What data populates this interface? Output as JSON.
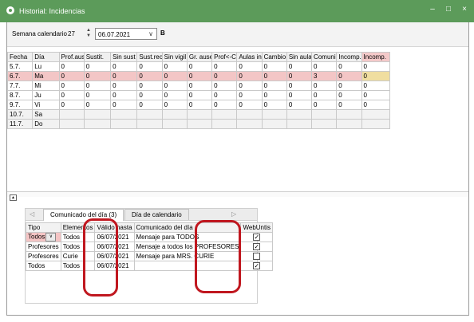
{
  "window": {
    "title": "Historial: Incidencias",
    "minimize": "–",
    "maximize": "□",
    "close": "×"
  },
  "toolbar": {
    "week_label": "Semana calendario",
    "week_value": "27",
    "date_value": "06.07.2021",
    "b_label": "B"
  },
  "grid": {
    "headers": [
      "Fecha",
      "Día",
      "Prof.aus",
      "Sustit.",
      "Sin sust",
      "Sust.rec",
      "Sin vigil",
      "Gr. ause",
      "Prof<-C",
      "Aulas in",
      "Cambio",
      "Sin aula",
      "Comuni",
      "Incomp.",
      "Incomp."
    ],
    "rows": [
      {
        "fecha": "5.7.",
        "dia": "Lu",
        "values": [
          "0",
          "0",
          "0",
          "0",
          "0",
          "0",
          "0",
          "0",
          "0",
          "0",
          "0",
          "0",
          "0"
        ]
      },
      {
        "fecha": "6.7.",
        "dia": "Ma",
        "values": [
          "0",
          "0",
          "0",
          "0",
          "0",
          "0",
          "0",
          "0",
          "0",
          "0",
          "3",
          "0",
          "0"
        ]
      },
      {
        "fecha": "7.7.",
        "dia": "Mi",
        "values": [
          "0",
          "0",
          "0",
          "0",
          "0",
          "0",
          "0",
          "0",
          "0",
          "0",
          "0",
          "0",
          "0"
        ]
      },
      {
        "fecha": "8.7.",
        "dia": "Ju",
        "values": [
          "0",
          "0",
          "0",
          "0",
          "0",
          "0",
          "0",
          "0",
          "0",
          "0",
          "0",
          "0",
          "0"
        ]
      },
      {
        "fecha": "9.7.",
        "dia": "Vi",
        "values": [
          "0",
          "0",
          "0",
          "0",
          "0",
          "0",
          "0",
          "0",
          "0",
          "0",
          "0",
          "0",
          "0"
        ]
      },
      {
        "fecha": "10.7.",
        "dia": "Sa",
        "values": [
          "",
          "",
          "",
          "",
          "",
          "",
          "",
          "",
          "",
          "",
          "",
          "",
          ""
        ]
      },
      {
        "fecha": "11.7.",
        "dia": "Do",
        "values": [
          "",
          "",
          "",
          "",
          "",
          "",
          "",
          "",
          "",
          "",
          "",
          "",
          ""
        ]
      }
    ]
  },
  "panel": {
    "tabs": [
      "Comunicado del día (3)",
      "Día de calendario"
    ],
    "nav_left": "◁",
    "nav_right": "▷",
    "headers": [
      "Tipo",
      "Elementos",
      "Válido hasta",
      "Comunicado del día",
      "WebUntis"
    ],
    "rows": [
      {
        "tipo": "Todos",
        "elementos": "Todos",
        "valido": "06/07/2021",
        "comunicado": "Mensaje para TODOS",
        "webuntis": true
      },
      {
        "tipo": "Profesores",
        "elementos": "Todos",
        "valido": "06/07/2021",
        "comunicado": "Mensaje a todos los PROFESORES",
        "webuntis": true
      },
      {
        "tipo": "Profesores",
        "elementos": "Curie",
        "valido": "06/07/2021",
        "comunicado": "Mensaje para MRS. CURIE",
        "webuntis": false
      },
      {
        "tipo": "Todos",
        "elementos": "Todos",
        "valido": "06/07/2021",
        "comunicado": "",
        "webuntis": true
      }
    ]
  },
  "colors": {
    "titlebar": "#5c9b5a",
    "highlight_row": "#f3c6c6",
    "incomp_cell": "#f5e3a5",
    "annotation": "#c0171f"
  },
  "icons": {
    "app": "app-globe-icon",
    "spin": "spin-updown-icon",
    "dropdown": "chevron-down-icon",
    "collapse": "collapse-up-icon",
    "checkbox": "checkbox-icon"
  }
}
